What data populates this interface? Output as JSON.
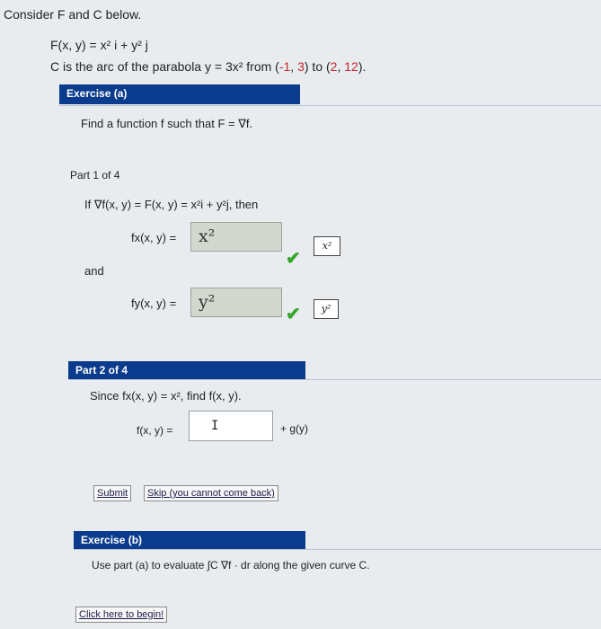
{
  "intro": {
    "consider_label": "Consider F and C below.",
    "field_prefix": "F(x, y) =",
    "field_expr": "x² i + y² j",
    "curve_prefix": "C is the arc of the parabola y = 3x² from (",
    "p1x": "-1",
    "p1y": "3",
    "p2x": "2",
    "p2y": "12",
    "sep": ", ",
    "mid": ") to (",
    "end": ")."
  },
  "exercise_a": {
    "title": "Exercise (a)",
    "prompt": "Find a function f such that F = ∇f."
  },
  "part1": {
    "title": "Part 1 of 4",
    "statement": "If ∇f(x, y) = F(x, y) = x²i + y²j, then",
    "fx_label": "fx(x, y) =",
    "fx_value": "x²",
    "fx_chip": "x²",
    "and_label": "and",
    "fy_label": "fy(x, y) =",
    "fy_value": "y²",
    "fy_chip": "y²",
    "check_glyph": "✔",
    "check_color": "#35a52b"
  },
  "part2": {
    "title": "Part 2 of 4",
    "statement": "Since fx(x, y) = x², find f(x, y).",
    "f_label": "f(x, y) =",
    "f_value": "",
    "cursor_glyph": "I",
    "suffix": "+ g(y)",
    "submit_label": "Submit",
    "skip_label": "Skip (you cannot come back)"
  },
  "exercise_b": {
    "title": "Exercise (b)",
    "prompt": "Use part (a) to evaluate ∫C ∇f · dr along the given curve C.",
    "begin_label": "Click here to begin!"
  },
  "colors": {
    "header_bg": "#0b3b8c",
    "accent_red": "#c1272d",
    "check": "#35a52b"
  }
}
